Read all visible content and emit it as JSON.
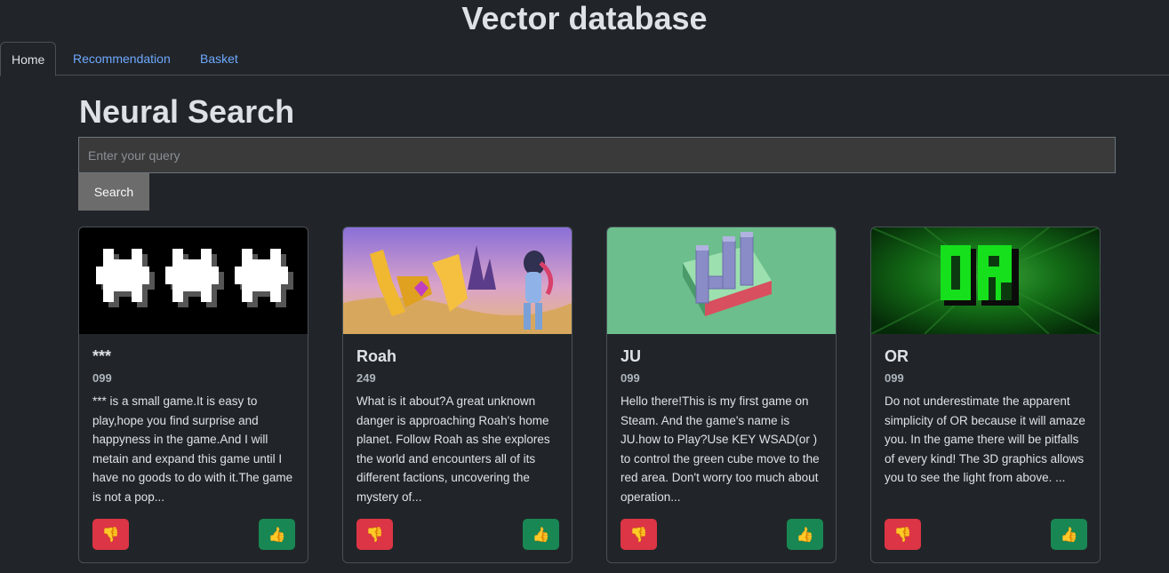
{
  "app": {
    "title": "Vector database"
  },
  "tabs": [
    {
      "label": "Home",
      "active": true
    },
    {
      "label": "Recommendation",
      "active": false
    },
    {
      "label": "Basket",
      "active": false
    }
  ],
  "main": {
    "title": "Neural Search",
    "search": {
      "placeholder": "Enter your query",
      "value": "",
      "button_label": "Search"
    }
  },
  "cards": [
    {
      "title": "***",
      "subtitle": "099",
      "description": "*** is a small game.It is easy to play,hope you find surprise and happyness in the game.And I will metain and expand this game until I have no goods to do with it.The game is not a pop...",
      "image": "three-asterisk-art"
    },
    {
      "title": "Roah",
      "subtitle": "249",
      "description": "What is it about?A great unknown danger is approaching Roah's home planet. Follow Roah as she explores the world and encounters all of its different factions, uncovering the mystery of...",
      "image": "roah-art"
    },
    {
      "title": "JU",
      "subtitle": "099",
      "description": "Hello there!This is my first game on Steam. And the game's name is JU.how to Play?Use KEY WSAD(or ) to control the green cube move to the red area. Don't worry too much about operation...",
      "image": "ju-art"
    },
    {
      "title": "OR",
      "subtitle": "099",
      "description": "Do not underestimate the apparent simplicity of OR because it will amaze you. In the game there will be pitfalls of every kind! The 3D graphics allows you to see the light from above. ...",
      "image": "or-art"
    }
  ],
  "buttons": {
    "dislike_icon": "thumbs-down-icon",
    "like_icon": "thumbs-up-icon",
    "dislike_glyph": "👎",
    "like_glyph": "👍"
  },
  "colors": {
    "background": "#212529",
    "link": "#6ea8fe",
    "dislike": "#dc3545",
    "like": "#198754"
  }
}
